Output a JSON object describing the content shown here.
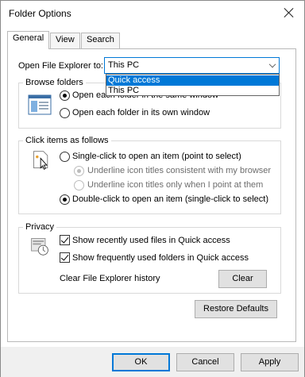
{
  "window": {
    "title": "Folder Options"
  },
  "tabs": [
    {
      "label": "General"
    },
    {
      "label": "View"
    },
    {
      "label": "Search"
    }
  ],
  "open_explorer": {
    "label": "Open File Explorer to:",
    "value": "This PC",
    "options": [
      "Quick access",
      "This PC"
    ],
    "highlighted": "Quick access"
  },
  "browse_folders": {
    "title": "Browse folders",
    "options": [
      {
        "label": "Open each folder in the same window",
        "selected": true
      },
      {
        "label": "Open each folder in its own window",
        "selected": false
      }
    ]
  },
  "click_items": {
    "title": "Click items as follows",
    "single_click": "Single-click to open an item (point to select)",
    "underline_consistent": "Underline icon titles consistent with my browser",
    "underline_point": "Underline icon titles only when I point at them",
    "double_click": "Double-click to open an item (single-click to select)"
  },
  "privacy": {
    "title": "Privacy",
    "recent_files": "Show recently used files in Quick access",
    "frequent_folders": "Show frequently used folders in Quick access",
    "clear_history_label": "Clear File Explorer history",
    "clear_button": "Clear"
  },
  "restore_defaults": "Restore Defaults",
  "footer": {
    "ok": "OK",
    "cancel": "Cancel",
    "apply": "Apply"
  }
}
